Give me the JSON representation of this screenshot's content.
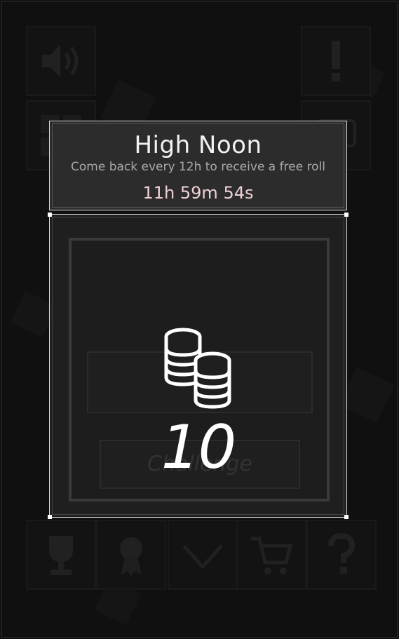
{
  "header": {
    "title": "High Noon",
    "subtitle": "Come back every 12h to receive a free roll",
    "timer": "11h 59m 54s"
  },
  "reward": {
    "icon": "coins-icon",
    "amount": "10"
  },
  "background": {
    "top_left_icons": [
      "speaker-icon",
      "grid-icon"
    ],
    "top_right_icons": [
      "exclamation-icon",
      "chat-icon"
    ],
    "bottom_bar_icons": [
      "trophy-icon",
      "award-icon",
      "chevron-down-icon",
      "cart-icon",
      "question-icon"
    ],
    "ghost_button_label": "Challenge"
  },
  "colors": {
    "timer": "#f0d2d6",
    "panel_border": "#d9d9d9",
    "background": "#121212"
  }
}
